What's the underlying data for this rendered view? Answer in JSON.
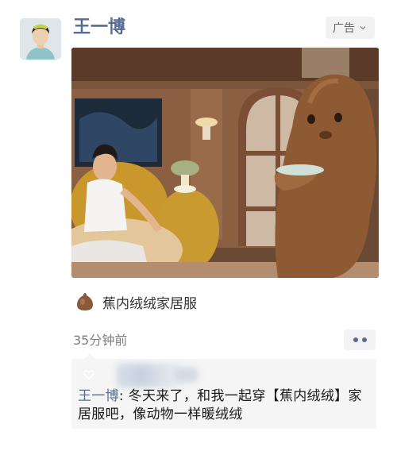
{
  "post": {
    "author": "王一博",
    "ad_badge": "广告",
    "brand_name": "蕉内绒绒家居服",
    "timestamp": "35分钟前"
  },
  "comment": {
    "author": "王一博",
    "separator": ": ",
    "text": "冬天来了，和我一起穿【蕉内绒绒】家居服吧，像动物一样暖绒绒"
  },
  "icons": {
    "ad_dropdown": "chevron-down-icon",
    "more": "more-dots-icon",
    "like": "heart-icon"
  },
  "colors": {
    "name_link": "#576b95",
    "comment_bg": "#f5f5f5",
    "badge_bg": "#f2f2f2",
    "timestamp": "#7f7f7f"
  }
}
